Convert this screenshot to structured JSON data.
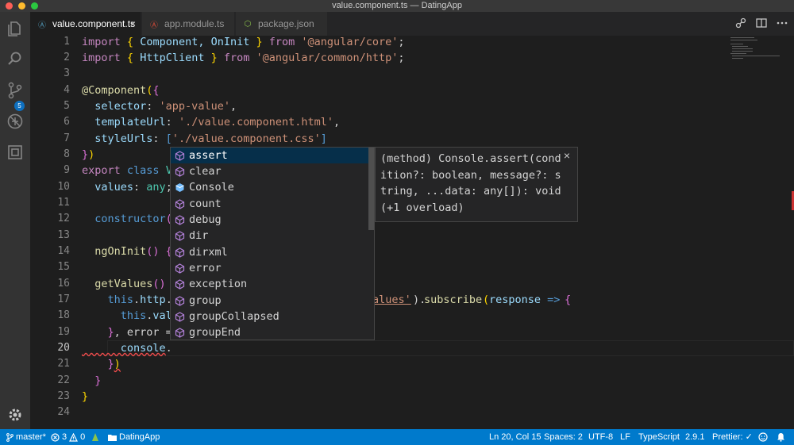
{
  "window": {
    "title": "value.component.ts — DatingApp"
  },
  "activity_bar": {
    "source_control_badge": "5",
    "items": [
      "explorer-icon",
      "search-icon",
      "source-control-icon",
      "debug-icon",
      "extensions-icon",
      "gear-icon"
    ]
  },
  "tabs": [
    {
      "label": "value.component.ts",
      "icon": "angular-icon",
      "active": true,
      "close": "×"
    },
    {
      "label": "app.module.ts",
      "icon": "angular-icon",
      "active": false
    },
    {
      "label": "package.json",
      "icon": "nodejs-icon",
      "active": false
    }
  ],
  "editor": {
    "line_numbers": [
      "1",
      "2",
      "3",
      "4",
      "5",
      "6",
      "7",
      "8",
      "9",
      "10",
      "11",
      "12",
      "13",
      "14",
      "15",
      "16",
      "17",
      "18",
      "19",
      "20",
      "21",
      "22",
      "23",
      "24"
    ],
    "current_line": "20",
    "code": {
      "l1": [
        "import",
        " ",
        "{",
        " Component, OnInit ",
        "}",
        " from ",
        "'@angular/core'",
        ";"
      ],
      "l2": [
        "import",
        " ",
        "{",
        " HttpClient ",
        "}",
        " from ",
        "'@angular/common/http'",
        ";"
      ],
      "l4": [
        "@Component",
        "(",
        "{"
      ],
      "l5": [
        "  selector",
        ": ",
        "'app-value'",
        ","
      ],
      "l6": [
        "  templateUrl",
        ": ",
        "'./value.component.html'",
        ","
      ],
      "l7": [
        "  styleUrls",
        ": ",
        "[",
        "'./value.component.css'",
        "]"
      ],
      "l8": [
        "}",
        ")"
      ],
      "l9": [
        "export",
        " ",
        "class",
        " V"
      ],
      "l10": [
        "  values",
        ": ",
        "any",
        ";"
      ],
      "l12": [
        "  constructor",
        "("
      ],
      "l14": [
        "  ngOnInit",
        "() ",
        "{"
      ],
      "l16": [
        "  getValues",
        "()"
      ],
      "l17": [
        "    this",
        ".",
        "http",
        ".",
        "alues'",
        ").",
        "subscribe",
        "(",
        "response",
        " => ",
        "{"
      ],
      "l18": [
        "      this",
        ".",
        "val"
      ],
      "l19": [
        "    ",
        "}",
        ", error ="
      ],
      "l20": [
        "      console",
        "."
      ],
      "l21": [
        "    ",
        "}",
        ")"
      ],
      "l22": [
        "  ",
        "}"
      ],
      "l23": [
        "}"
      ]
    }
  },
  "suggestions": [
    {
      "label": "assert",
      "icon": "method-icon",
      "selected": true
    },
    {
      "label": "clear",
      "icon": "method-icon"
    },
    {
      "label": "Console",
      "icon": "class-icon"
    },
    {
      "label": "count",
      "icon": "method-icon"
    },
    {
      "label": "debug",
      "icon": "method-icon"
    },
    {
      "label": "dir",
      "icon": "method-icon"
    },
    {
      "label": "dirxml",
      "icon": "method-icon"
    },
    {
      "label": "error",
      "icon": "method-icon"
    },
    {
      "label": "exception",
      "icon": "method-icon"
    },
    {
      "label": "group",
      "icon": "method-icon"
    },
    {
      "label": "groupCollapsed",
      "icon": "method-icon"
    },
    {
      "label": "groupEnd",
      "icon": "method-icon"
    }
  ],
  "detail": {
    "text": "(method) Console.assert(condition?: boolean, message?: string, ...data: any[]): void (+1 overload)",
    "close": "×"
  },
  "status_bar": {
    "branch": "master*",
    "errors": "3",
    "warnings": "0",
    "folder": "DatingApp",
    "position": "Ln 20, Col 15",
    "spaces": "Spaces: 2",
    "encoding": "UTF-8",
    "eol": "LF",
    "language": "TypeScript",
    "version": "2.9.1",
    "prettier": "Prettier: ✓"
  },
  "colors": {
    "status_bar": "#007acc",
    "editor_bg": "#1e1e1e",
    "selected_suggestion": "#062f4a"
  }
}
